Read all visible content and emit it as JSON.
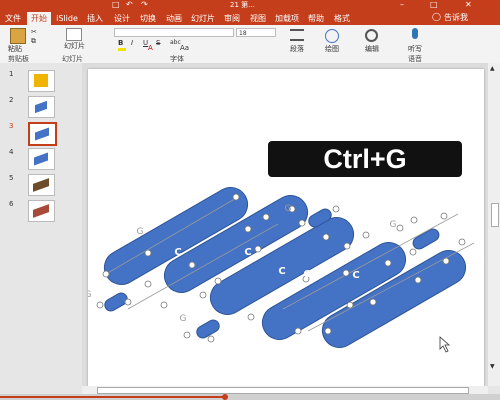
{
  "title_text": "21 第...",
  "tabs": [
    "文件",
    "开始",
    "iSlide",
    "插入",
    "设计",
    "切换",
    "动画",
    "幻灯片",
    "审阅",
    "视图",
    "加载项",
    "帮助",
    "格式"
  ],
  "search_label": "告诉我",
  "ribbon": {
    "paste_label": "粘贴",
    "new_slide_label": "幻灯片",
    "font_size_value": "18",
    "paragraph_label": "段落",
    "drawing_label": "绘图",
    "editing_label": "编辑",
    "voice_label": "听写",
    "clipboard_group": "剪贴板",
    "slides_group": "幻灯片",
    "font_group": "字体",
    "voice_group": "语音",
    "bold": "B",
    "italic": "I",
    "underline": "U",
    "strike": "S",
    "abc": "abc",
    "fontcolor": "A",
    "aa": "Aa"
  },
  "slide_numbers": [
    "1",
    "2",
    "3",
    "4",
    "5",
    "6"
  ],
  "shortcut_label": "Ctrl+G",
  "group_glyph": "G",
  "cap_letter": "C",
  "colors": {
    "accent": "#c43e1c",
    "shape_fill": "#4472c4",
    "label_bg": "#111111"
  }
}
